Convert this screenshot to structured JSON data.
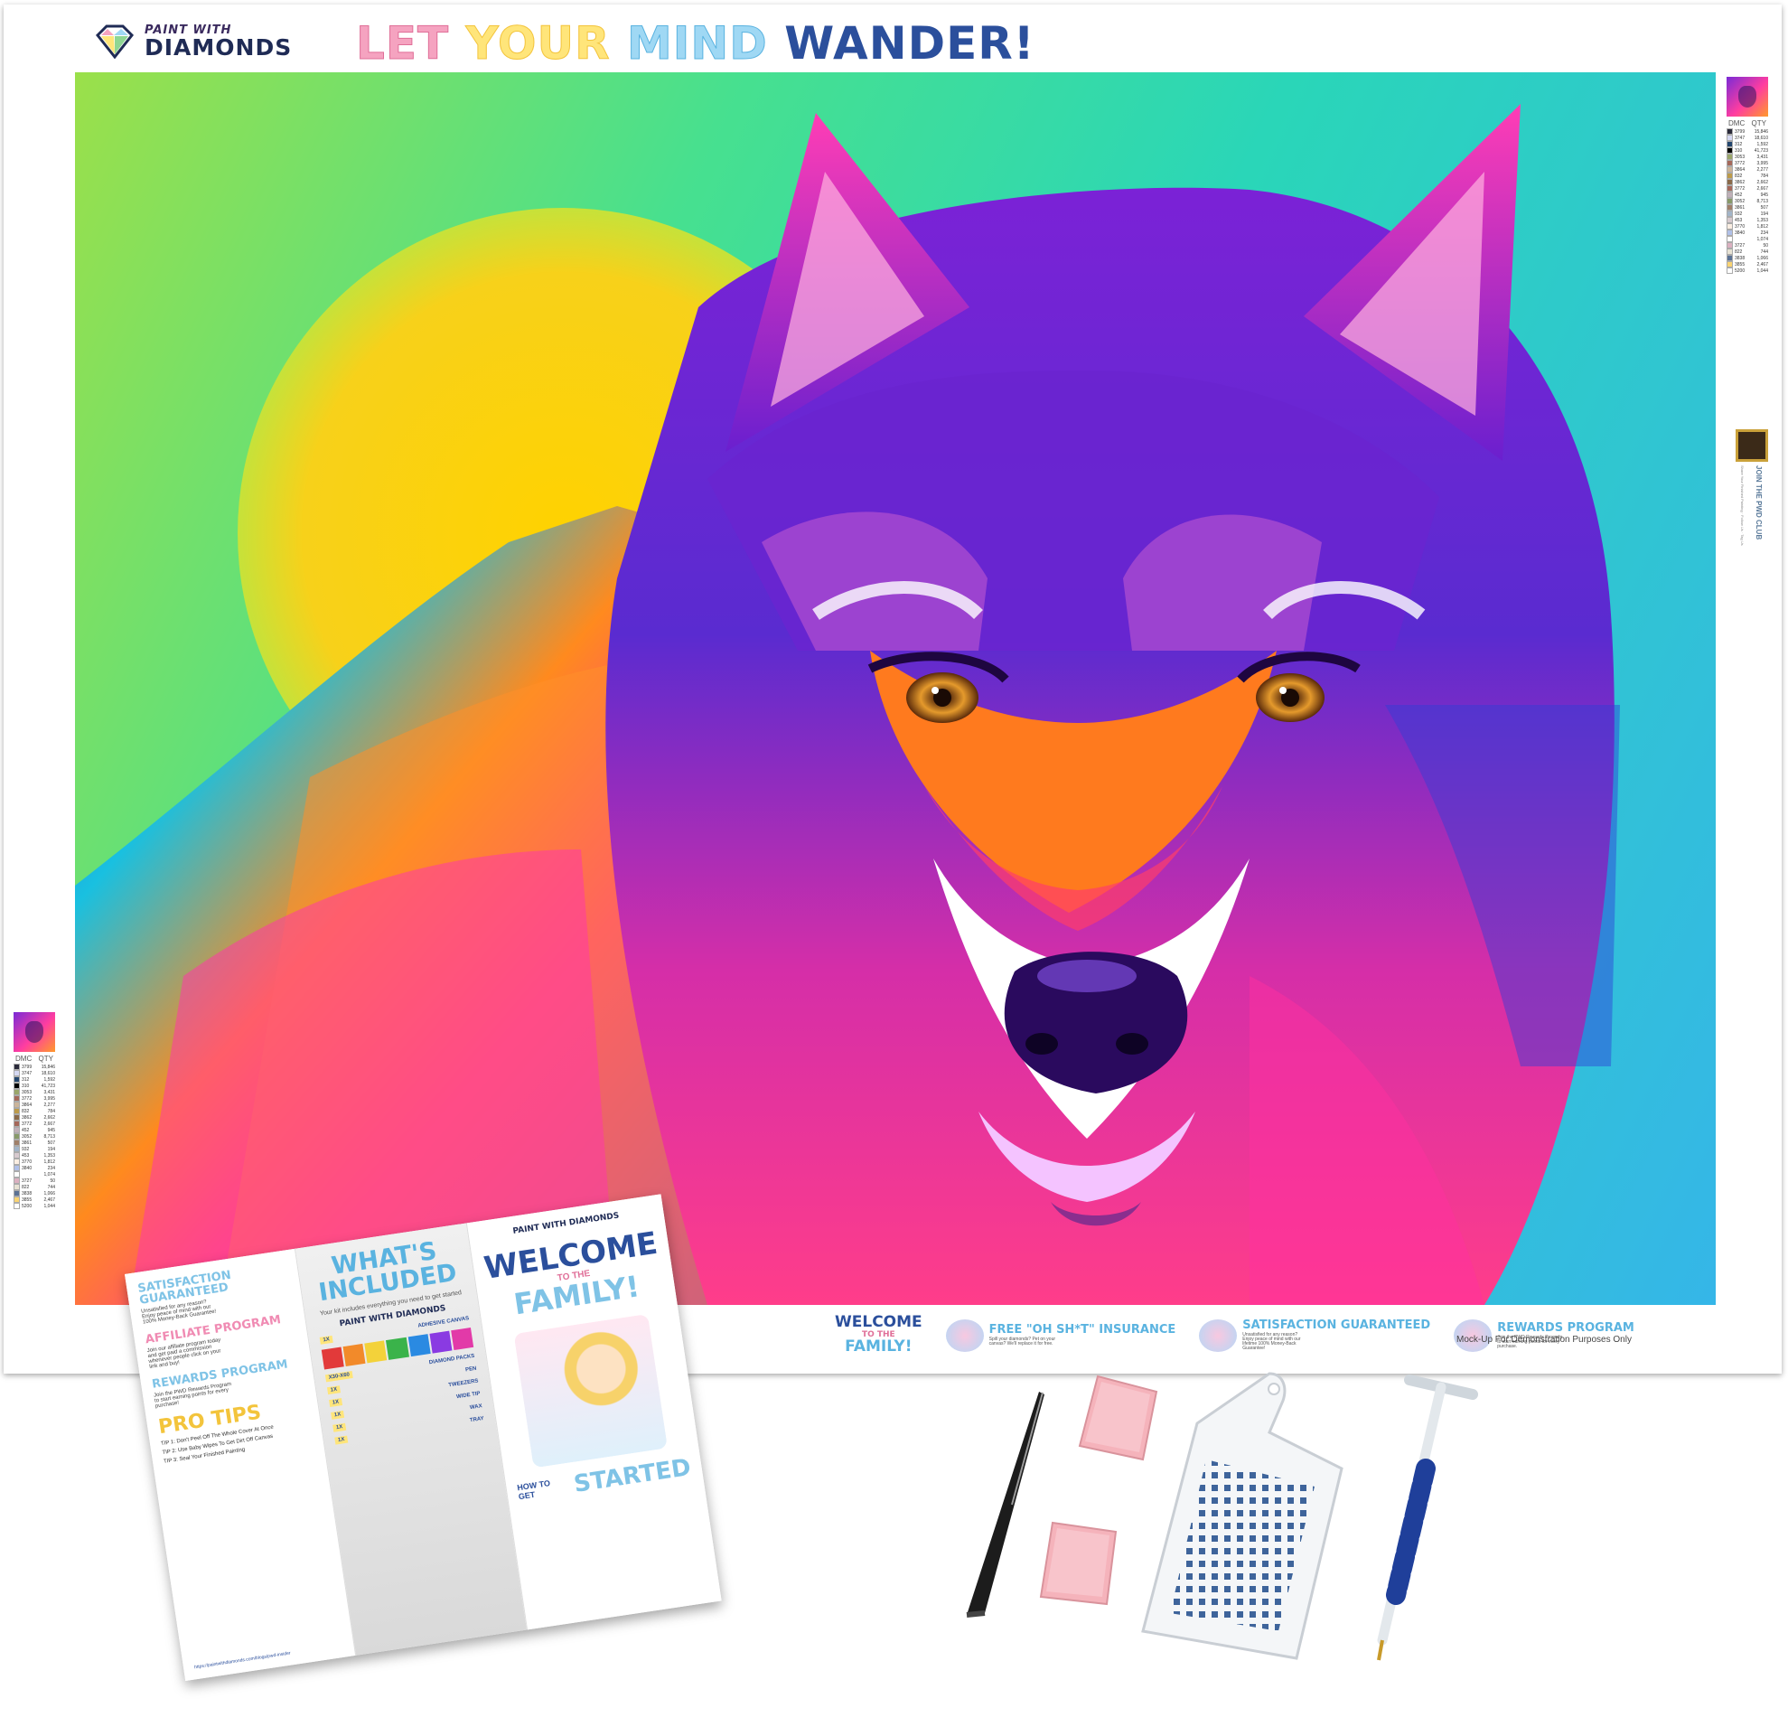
{
  "poster": {
    "brand_top": "PAINT WITH",
    "brand_main": "DIAMONDS",
    "headline": [
      "LET",
      "YOUR",
      "MIND",
      "WANDER!"
    ],
    "legend_header": [
      "DMC",
      "QTY"
    ],
    "legend_rows": [
      {
        "code": "3799",
        "qty": "15,846",
        "color": "#2a2a3a"
      },
      {
        "code": "3747",
        "qty": "18,610",
        "color": "#d4d8f2"
      },
      {
        "code": "312",
        "qty": "1,592",
        "color": "#23466e"
      },
      {
        "code": "310",
        "qty": "41,723",
        "color": "#000000"
      },
      {
        "code": "3053",
        "qty": "3,431",
        "color": "#9aa66a"
      },
      {
        "code": "3772",
        "qty": "3,995",
        "color": "#a5685a"
      },
      {
        "code": "3864",
        "qty": "2,277",
        "color": "#cbb49a"
      },
      {
        "code": "832",
        "qty": "784",
        "color": "#bd9b4a"
      },
      {
        "code": "3862",
        "qty": "2,662",
        "color": "#8a6a4a"
      },
      {
        "code": "3772",
        "qty": "2,667",
        "color": "#a5685a"
      },
      {
        "code": "452",
        "qty": "945",
        "color": "#c0b0b8"
      },
      {
        "code": "3052",
        "qty": "8,713",
        "color": "#889a6a"
      },
      {
        "code": "3861",
        "qty": "507",
        "color": "#a0806a"
      },
      {
        "code": "932",
        "qty": "194",
        "color": "#a2b4c8"
      },
      {
        "code": "453",
        "qty": "1,353",
        "color": "#d7cacf"
      },
      {
        "code": "3770",
        "qty": "1,812",
        "color": "#fbeee2"
      },
      {
        "code": "3840",
        "qty": "234",
        "color": "#b0c0e8"
      },
      {
        "code": "",
        "qty": "1,074",
        "color": "#ffffff"
      },
      {
        "code": "3727",
        "qty": "50",
        "color": "#dbb0c0"
      },
      {
        "code": "822",
        "qty": "744",
        "color": "#e7e2d3"
      },
      {
        "code": "3838",
        "qty": "1,066",
        "color": "#5c7294"
      },
      {
        "code": "3855",
        "qty": "2,467",
        "color": "#fad471"
      },
      {
        "code": "5200",
        "qty": "1,044",
        "color": "#ffffff"
      }
    ],
    "join_title": "JOIN THE PWD CLUB",
    "join_small": "Share Your Finished Painting · Follow Us · Tag Us",
    "mockup_note": "Mock-Up For Demonstration Purposes Only",
    "footer": {
      "welcome": [
        "WELCOME",
        "TO THE",
        "FAMILY!"
      ],
      "blocks": [
        {
          "title": "FREE \"OH SH*T\" INSURANCE",
          "text": "Spill your diamonds? Pet on your canvas? We'll replace it for free."
        },
        {
          "title": "SATISFACTION GUARANTEED",
          "text": "Unsatisfied for any reason? Enjoy peace of mind with our lifetime 100% Money-Back Guarantee!"
        },
        {
          "title": "REWARDS PROGRAM",
          "text": "Join the PWD Rewards Program to start earning points for every purchase."
        }
      ]
    }
  },
  "brochure": {
    "panel1": {
      "sat_title": "SATISFACTION GUARANTEED",
      "sat_text": "Unsatisfied for any reason? Enjoy peace of mind with our 100% Money-Back Guarantee!",
      "aff_title": "AFFILIATE PROGRAM",
      "aff_text": "Join our affiliate program today and get paid a commission whenever people click on your link and buy!",
      "rew_title": "REWARDS PROGRAM",
      "rew_text": "Join the PWD Rewards Program to start earning points for every purchase!",
      "tips_title": "PRO TIPS",
      "tip1": "TIP 1: Don't Peel Off The Whole Cover At Once",
      "tip2": "TIP 2: Use Baby Wipes To Get Dirt Off Canvas",
      "tip3": "TIP 3: Seal Your Finished Painting",
      "url": "https://paintwithdiamonds.com/blogs/pwd-insider"
    },
    "panel2": {
      "title": "WHAT'S INCLUDED",
      "subtitle": "Your kit includes everything you need to get started",
      "brand": "PAINT WITH DIAMONDS",
      "items": [
        {
          "qty": "1X",
          "name": "ADHESIVE CANVAS"
        },
        {
          "qty": "X30-X60",
          "name": "DIAMOND PACKS"
        },
        {
          "qty": "1X",
          "name": "PEN"
        },
        {
          "qty": "1X",
          "name": "TWEEZERS"
        },
        {
          "qty": "1X",
          "name": "WIDE TIP"
        },
        {
          "qty": "1X",
          "name": "WAX"
        },
        {
          "qty": "1X",
          "name": "TRAY"
        }
      ]
    },
    "panel3": {
      "brand": "PAINT WITH DIAMONDS",
      "welcome": "WELCOME",
      "to_the": "TO THE",
      "family": "FAMILY!",
      "how_to_get": "HOW TO GET",
      "started": "STARTED"
    }
  },
  "colors": {
    "brand_navy": "#1f2b55",
    "accent_blue": "#5ab3e0",
    "accent_pink": "#e06f98",
    "accent_yellow": "#f3c43c"
  }
}
